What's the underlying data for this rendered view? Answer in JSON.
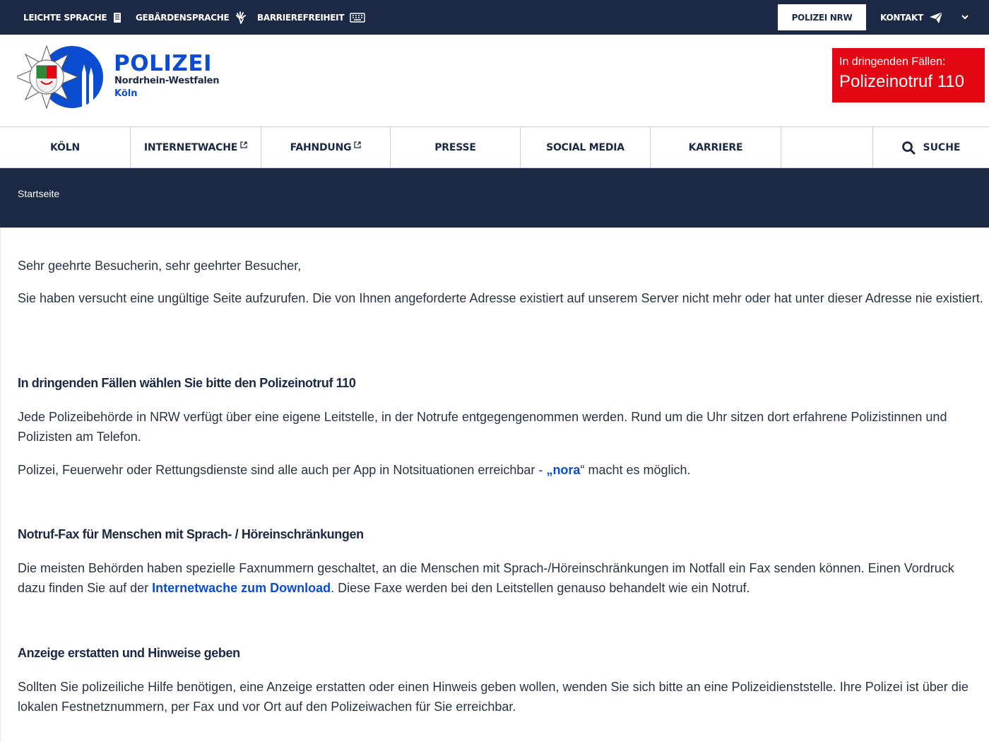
{
  "topbar": {
    "leichte_sprache": "LEICHTE SPRACHE",
    "gebaerdensprache": "GEBÄRDENSPRACHE",
    "barrierefreiheit": "BARRIEREFREIHEIT",
    "polizei_nrw": "POLIZEI NRW",
    "kontakt": "KONTAKT"
  },
  "header": {
    "logo_title": "POLIZEI",
    "logo_subtitle": "Nordrhein-Westfalen",
    "logo_city": "Köln",
    "emergency_line1": "In dringenden Fällen:",
    "emergency_line2": "Polizeinotruf 110"
  },
  "nav": {
    "items": [
      {
        "label": "KÖLN",
        "external": false
      },
      {
        "label": "INTERNETWACHE",
        "external": true
      },
      {
        "label": "FAHNDUNG",
        "external": true
      },
      {
        "label": "PRESSE",
        "external": false
      },
      {
        "label": "SOCIAL MEDIA",
        "external": false
      },
      {
        "label": "KARRIERE",
        "external": false
      }
    ],
    "search_label": "SUCHE"
  },
  "breadcrumb": {
    "current": "Startseite"
  },
  "content": {
    "greeting": "Sehr geehrte Besucherin, sehr geehrter Besucher,",
    "intro": "Sie haben versucht eine ungültige Seite aufzurufen. Die von Ihnen angeforderte Adresse existiert auf unserem Server nicht mehr oder hat unter dieser Adresse nie existiert.",
    "section1": {
      "heading": "In dringenden Fällen wählen Sie bitte den Polizeinotruf 110",
      "p1": "Jede Polizeibehörde in NRW verfügt über eine eigene Leitstelle, in der Notrufe entgegengenommen werden. Rund um die Uhr sitzen dort erfahrene Polizistinnen und Polizisten am Telefon.",
      "p2_before": "Polizei, Feuerwehr oder Rettungsdienste sind alle auch per App in Notsituationen erreichbar - ",
      "p2_link": "„nora",
      "p2_after": "“ macht es möglich."
    },
    "section2": {
      "heading": "Notruf-Fax für Menschen mit Sprach- / Höreinschränkungen",
      "p_before": "Die meisten Behörden haben spezielle Faxnummern geschaltet, an die Menschen mit Sprach-/Höreinschränkungen im Notfall ein Fax senden können. Einen Vordruck dazu finden Sie auf der ",
      "p_link": "Internetwache zum Download",
      "p_after": ". Diese Faxe werden bei den Leitstellen genauso behandelt wie ein Notruf."
    },
    "section3": {
      "heading": "Anzeige erstatten und Hinweise geben",
      "p": "Sollten Sie polizeiliche Hilfe benötigen, eine Anzeige erstatten oder einen Hinweis geben wollen, wenden Sie sich bitte an eine Polizeidienststelle. Ihre Polizei ist über die lokalen Festnetznummern, per Fax und vor Ort auf den Polizeiwachen für Sie erreichbar."
    }
  },
  "colors": {
    "navy": "#1c2945",
    "brand_blue": "#0b4cd1",
    "emergency_red": "#e30613"
  },
  "icons": [
    "book-icon",
    "sign-language-hand-icon",
    "keyboard-icon",
    "paper-plane-icon",
    "chevron-down-icon",
    "external-link-icon",
    "search-icon",
    "police-star-icon"
  ]
}
